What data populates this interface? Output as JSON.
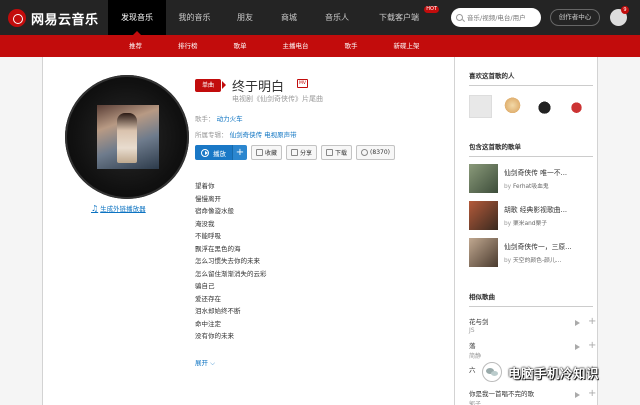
{
  "app": {
    "name": "网易云音乐"
  },
  "nav": [
    {
      "label": "发现音乐"
    },
    {
      "label": "我的音乐"
    },
    {
      "label": "朋友"
    },
    {
      "label": "商城"
    },
    {
      "label": "音乐人"
    },
    {
      "label": "下载客户端",
      "badge": "HOT"
    }
  ],
  "search": {
    "placeholder": "音乐/视频/电台/用户"
  },
  "header": {
    "creator_button": "创作者中心",
    "notification_count": "9"
  },
  "subnav": [
    "推荐",
    "排行榜",
    "歌单",
    "主播电台",
    "歌手",
    "新碟上架"
  ],
  "song": {
    "tag": "单曲",
    "title": "终于明白",
    "mv_label": "MV",
    "subtitle": "电视剧《仙剑奇侠传》片尾曲",
    "artist_label": "歌手：",
    "artist": "动力火车",
    "album_label": "所属专辑：",
    "album": "仙剑奇侠传 电视原声带",
    "external_link": "生成外链播放器"
  },
  "buttons": {
    "play": "播放",
    "add": "+",
    "collect": "收藏",
    "share": "分享",
    "download": "下载",
    "comment": "(8370)"
  },
  "lyrics": [
    "望着你",
    "慢慢离开",
    "宿命像漩水般",
    "淹没我",
    "不能呼吸",
    "飘浮在黑色的海",
    "怎么习惯失去你的未来",
    "怎么留住渐渐消失的云彩",
    "骗自己",
    "爱还存在",
    "泪水却始终不断",
    "命中注定",
    "没有你的未来"
  ],
  "expand_label": "展开",
  "sidebar": {
    "likers_title": "喜欢这首歌的人",
    "playlists_title": "包含这首歌的歌单",
    "playlists": [
      {
        "name": "仙剑奇侠传 唯一不...",
        "by_label": "by",
        "author": "Ferhat吸血鬼"
      },
      {
        "name": "胡歌 经典影视歌曲...",
        "by_label": "by",
        "author": "栗米and栗子"
      },
      {
        "name": "仙剑奇侠传一，三原...",
        "by_label": "by",
        "author": "天空的颜色-颜儿..."
      }
    ],
    "related_title": "相似歌曲",
    "related": [
      {
        "name": "花与剑",
        "artist": "JS"
      },
      {
        "name": "落",
        "artist": "简静"
      },
      {
        "name": "六",
        "artist": ""
      },
      {
        "name": "你是我一首唱不完的歌",
        "artist": "郭子"
      }
    ]
  },
  "watermark": {
    "text": "电脑手机冷知识"
  },
  "colors": {
    "brand_red": "#c20c0c",
    "topbar": "#242424",
    "link_blue": "#0c73c2",
    "play_blue": "#1a78c6"
  }
}
